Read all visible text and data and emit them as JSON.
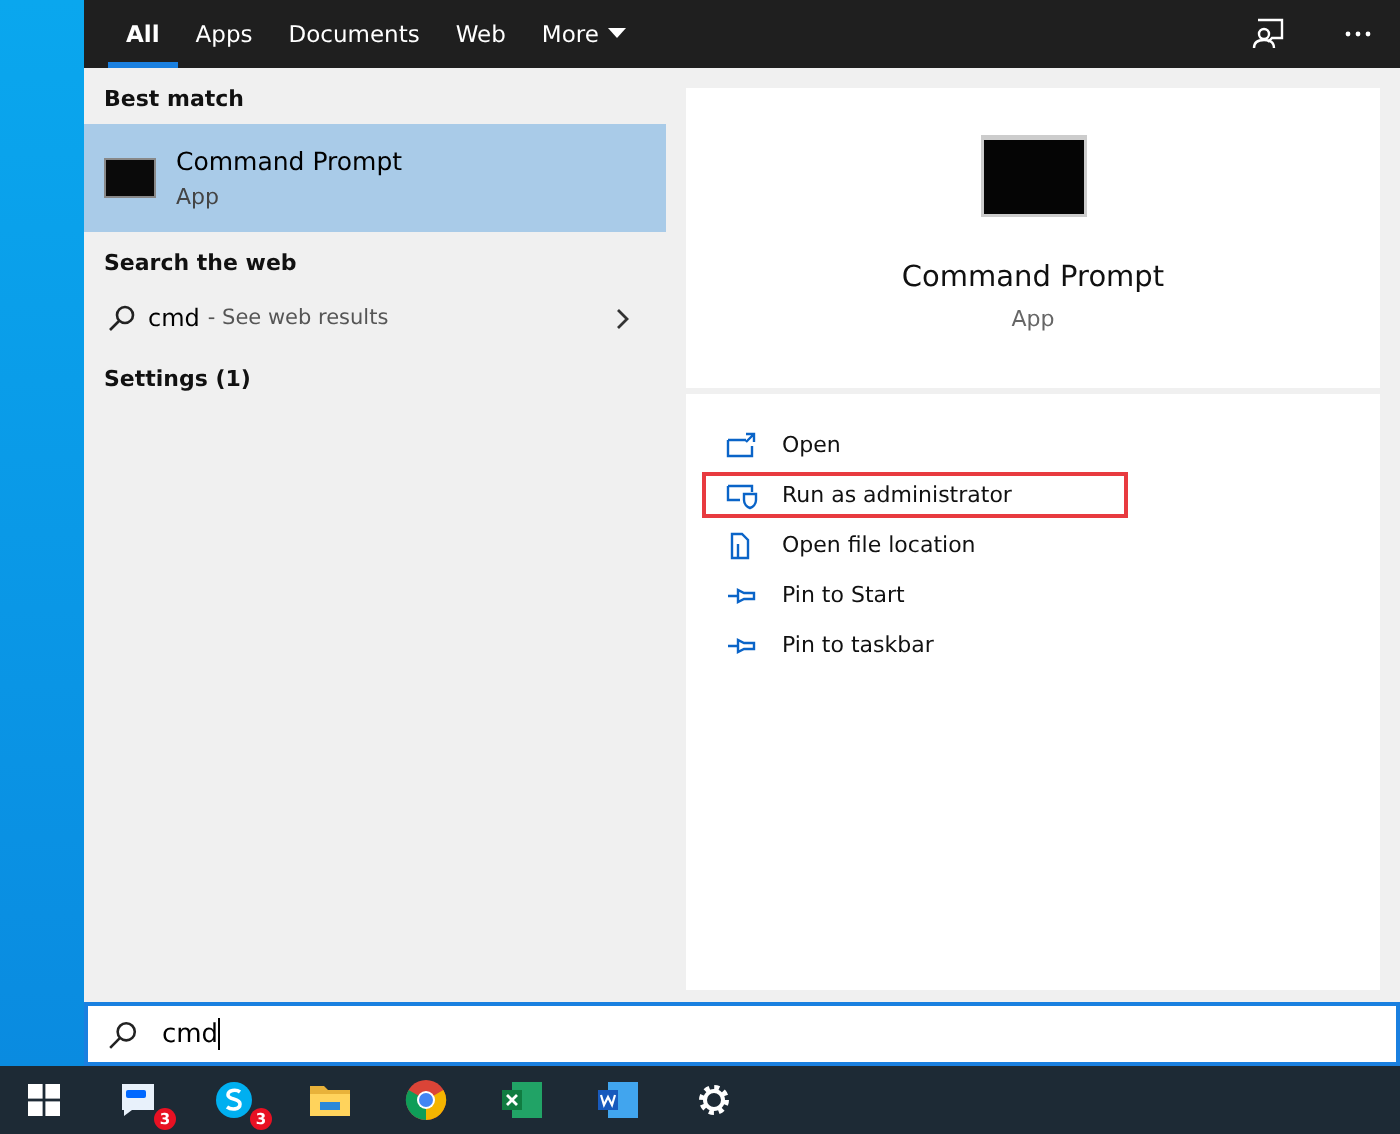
{
  "tabs": [
    {
      "label": "All",
      "selected": true
    },
    {
      "label": "Apps",
      "selected": false
    },
    {
      "label": "Documents",
      "selected": false
    },
    {
      "label": "Web",
      "selected": false
    },
    {
      "label": "More",
      "selected": false,
      "dropdown": true
    }
  ],
  "best_match": {
    "heading": "Best match",
    "item": {
      "title": "Command Prompt",
      "subtitle": "App",
      "selected": true
    }
  },
  "web": {
    "heading": "Search the web",
    "query": "cmd",
    "hint": "- See web results"
  },
  "settings": {
    "heading": "Settings (1)"
  },
  "preview": {
    "title": "Command Prompt",
    "subtitle": "App"
  },
  "actions": [
    {
      "kind": "open",
      "label": "Open",
      "highlighted": false
    },
    {
      "kind": "admin",
      "label": "Run as administrator",
      "highlighted": true
    },
    {
      "kind": "folder",
      "label": "Open file location",
      "highlighted": false
    },
    {
      "kind": "pin",
      "label": "Pin to Start",
      "highlighted": false
    },
    {
      "kind": "pin",
      "label": "Pin to taskbar",
      "highlighted": false
    }
  ],
  "search": {
    "value": "cmd"
  },
  "taskbar": [
    {
      "kind": "zalo",
      "badge": "3"
    },
    {
      "kind": "skype",
      "badge": "3"
    },
    {
      "kind": "folder"
    },
    {
      "kind": "chrome"
    },
    {
      "kind": "excel"
    },
    {
      "kind": "word"
    },
    {
      "kind": "settings"
    }
  ]
}
